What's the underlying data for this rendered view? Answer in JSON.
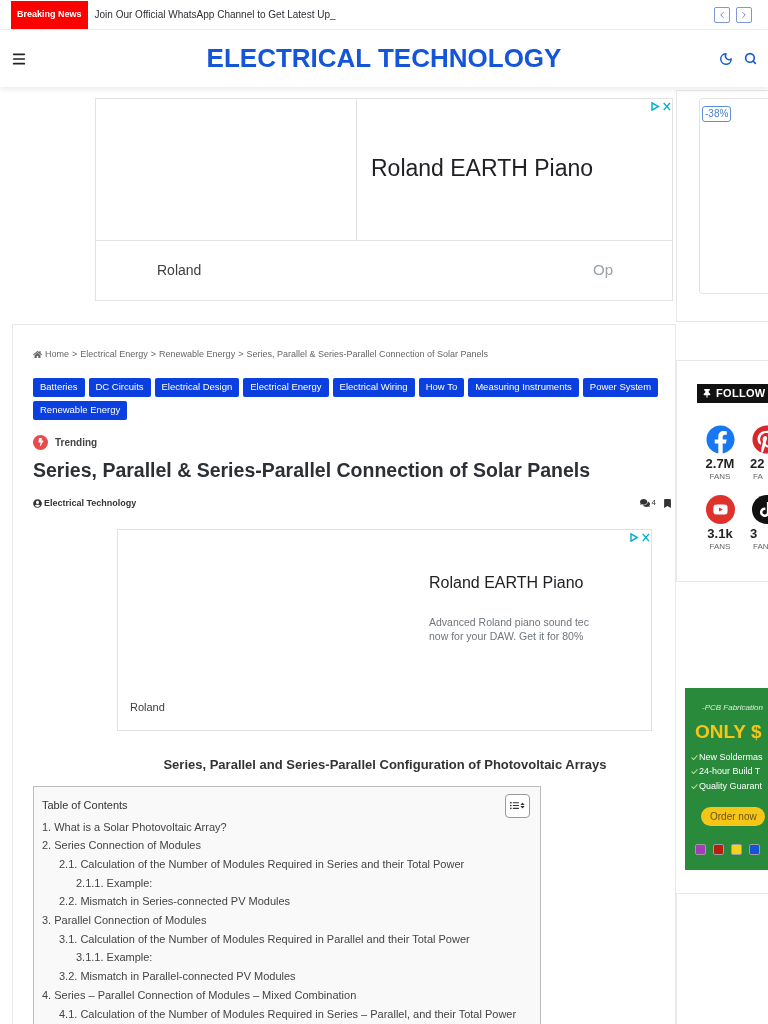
{
  "breaking_news": {
    "label": "Breaking News",
    "headline": "Join Our Official WhatsApp Channel to Get Latest Up_"
  },
  "header": {
    "logo": "ELECTRICAL TECHNOLOGY"
  },
  "top_ad": {
    "headline": "Roland EARTH Piano",
    "advertiser": "Roland",
    "button": "Op"
  },
  "sidebar_ad": {
    "badge": "-38%"
  },
  "article": {
    "breadcrumb": [
      {
        "label": "Home"
      },
      {
        "separator": ">",
        "label": "Electrical Energy"
      },
      {
        "separator": ">",
        "label": "Renewable Energy"
      },
      {
        "separator": ">",
        "label": "Series, Parallel & Series-Parallel Connection of Solar Panels"
      }
    ],
    "tags": [
      "Batteries",
      "DC Circuits",
      "Electrical Design",
      "Electrical Energy",
      "Electrical Wiring",
      "How To",
      "Measuring Instruments",
      "Power System",
      "Renewable Energy"
    ],
    "trending": "Trending",
    "title": "Series, Parallel & Series-Parallel Connection of Solar Panels",
    "author": "Electrical Technology",
    "comments": "4",
    "inline_ad": {
      "headline": "Roland EARTH Piano",
      "description": [
        "Advanced Roland piano sound tec",
        "now for your DAW. Get it for 80%"
      ],
      "advertiser": "Roland"
    },
    "caption": "Series, Parallel and Series-Parallel Configuration of Photovoltaic Arrays",
    "toc": {
      "title": "Table of Contents",
      "items": [
        {
          "label": "1. What is a Solar Photovoltaic Array?"
        },
        {
          "label": "2. Series Connection of Modules",
          "children": [
            {
              "label": "2.1. Calculation of the Number of Modules Required in Series and their Total Power",
              "children": [
                {
                  "label": "2.1.1. Example:"
                }
              ]
            },
            {
              "label": "2.2. Mismatch in Series-connected PV Modules"
            }
          ]
        },
        {
          "label": "3. Parallel Connection of Modules",
          "children": [
            {
              "label": "3.1. Calculation of the Number of Modules Required in Parallel and their Total Power",
              "children": [
                {
                  "label": "3.1.1. Example:"
                }
              ]
            },
            {
              "label": "3.2. Mismatch in Parallel-connected PV Modules"
            }
          ]
        },
        {
          "label": "4. Series – Parallel Connection of Modules – Mixed Combination",
          "children": [
            {
              "label": "4.1. Calculation of the Number of Modules Required in Series – Parallel, and their Total Power"
            }
          ]
        }
      ]
    }
  },
  "follow": {
    "title": "FOLLOW",
    "networks": [
      {
        "kind": "facebook",
        "count": "2.7M",
        "unit": "FANS"
      },
      {
        "kind": "pinterest",
        "count": "22",
        "unit": "FA"
      },
      {
        "kind": "youtube",
        "count": "3.1k",
        "unit": "FANS"
      },
      {
        "kind": "tiktok",
        "count": "3",
        "unit": "FAN"
      }
    ]
  },
  "pcb_ad": {
    "tagline": "-PCB Fabrication",
    "headline": "ONLY $",
    "features": [
      "New Soldermas",
      "24-hour Build T",
      "Quality Guarant"
    ],
    "button": "Order now",
    "swatches": [
      {
        "color": "#a23cb8"
      },
      {
        "color": "#b81d12"
      },
      {
        "color": "#f5d21c"
      },
      {
        "color": "#1652d6"
      }
    ]
  }
}
